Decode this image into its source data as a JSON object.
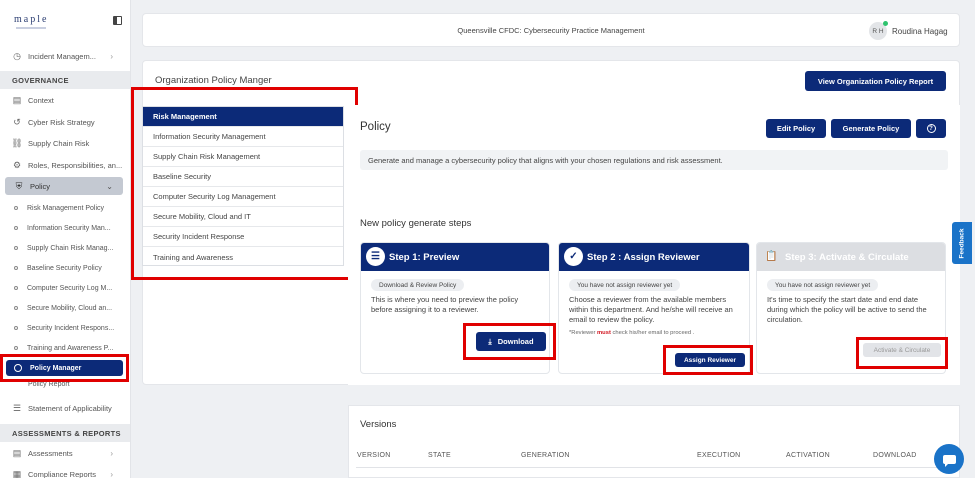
{
  "sidebar": {
    "logo": "maple",
    "items_top": [
      {
        "label": "Incident Managem...",
        "icon": "incident-icon"
      }
    ],
    "governance_header": "GOVERNANCE",
    "governance_items": [
      {
        "label": "Context",
        "icon": "document-icon"
      },
      {
        "label": "Cyber Risk Strategy",
        "icon": "strategy-icon"
      },
      {
        "label": "Supply Chain Risk",
        "icon": "supply-chain-icon"
      },
      {
        "label": "Roles, Responsibilities, an...",
        "icon": "roles-icon"
      }
    ],
    "policy_item": {
      "label": "Policy",
      "icon": "shield-icon"
    },
    "policy_sub": [
      "Risk Management Policy",
      "Information Security Man...",
      "Supply Chain Risk Manag...",
      "Baseline Security Policy",
      "Computer Security Log M...",
      "Secure Mobility, Cloud an...",
      "Security Incident Respons...",
      "Training and Awareness P..."
    ],
    "policy_manager": "Policy Manager",
    "policy_report": "Policy Report",
    "soa": "Statement of Applicability",
    "assess_header": "ASSESSMENTS & REPORTS",
    "assessments": "Assessments",
    "compliance": "Compliance Reports"
  },
  "topbar": {
    "title": "Queensville CFDC: Cybersecurity Practice Management",
    "avatar_initials": "R H",
    "username": "Roudina Hagag"
  },
  "main": {
    "org_title": "Organization Policy Manger",
    "view_report_btn": "View Organization Policy Report",
    "policy_list": [
      "Risk Management",
      "Information Security Management",
      "Supply Chain Risk Management",
      "Baseline Security",
      "Computer Security Log Management",
      "Secure Mobility, Cloud and IT",
      "Security Incident Response",
      "Training and Awareness"
    ],
    "policy_title": "Policy",
    "edit_btn": "Edit Policy",
    "generate_btn": "Generate Policy",
    "help_glyph": "?",
    "description": "Generate and manage a cybersecurity policy that aligns with your chosen regulations and risk assessment.",
    "steps_title": "New policy generate steps",
    "steps": [
      {
        "title": "Step 1: Preview",
        "pill": "Download & Review Policy",
        "text": "This is where you need to preview the policy before assigning it to a reviewer.",
        "button": "Download"
      },
      {
        "title": "Step 2 : Assign Reviewer",
        "pill": "You have not assign reviewer yet",
        "text": "Choose a reviewer from the available members within this department. And he/she will receive an email to review the policy.",
        "note_pre": "*Reviewer ",
        "note_strong": "must",
        "note_post": " check his/her email to proceed .",
        "button": "Assign Reviewer"
      },
      {
        "title": "Step 3: Activate & Circulate",
        "pill": "You have not assign reviewer yet",
        "text": "It's time to specify the start date and end date during which the policy will be active to send the circulation.",
        "button": "Activate & Circulate"
      }
    ]
  },
  "versions": {
    "title": "Versions",
    "columns": [
      "VERSION",
      "STATE",
      "GENERATION",
      "EXECUTION",
      "ACTIVATION",
      "DOWNLOAD"
    ]
  },
  "feedback": "Feedback",
  "colors": {
    "primary": "#0c2a78",
    "highlight": "#e00000",
    "accent": "#1a73c8"
  }
}
